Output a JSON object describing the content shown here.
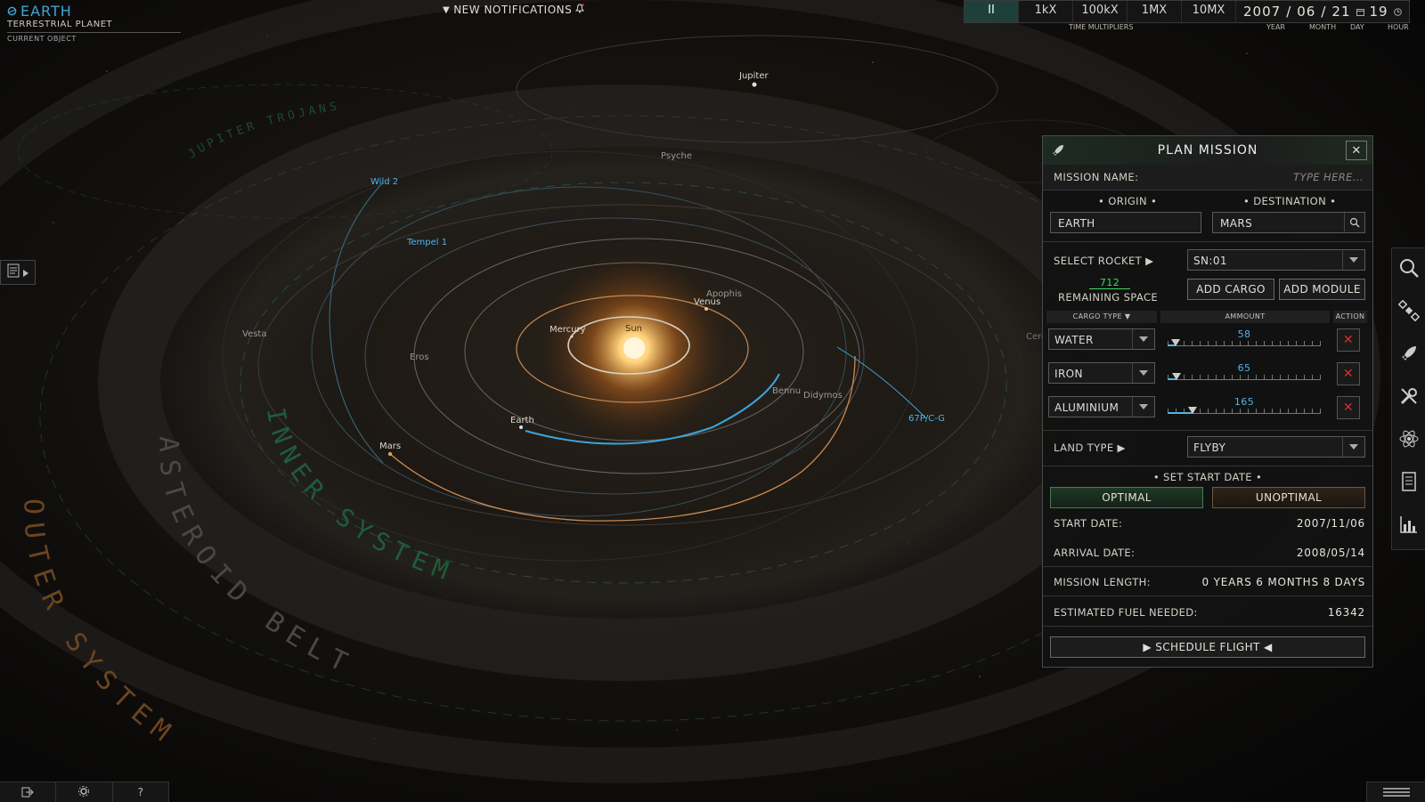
{
  "current_object": {
    "name": "EARTH",
    "type": "TERRESTRIAL PLANET",
    "label": "CURRENT OBJECT"
  },
  "notifications": {
    "label": "NEW NOTIFICATIONS"
  },
  "time": {
    "buttons": [
      "II",
      "1kX",
      "100kX",
      "1MX",
      "10MX"
    ],
    "year": "2007",
    "month": "06",
    "day": "21",
    "hour": "19",
    "multipliers_label": "TIME MULTIPLIERS",
    "labels": {
      "year": "YEAR",
      "month": "MONTH",
      "day": "DAY",
      "hour": "HOUR"
    }
  },
  "map": {
    "bodies": [
      "Jupiter",
      "Psyche",
      "Wild 2",
      "Tempel 1",
      "Vesta",
      "Eros",
      "Mercury",
      "Sun",
      "Venus",
      "Apophis",
      "Earth",
      "Mars",
      "Bennu",
      "Didymos",
      "Ceres",
      "67P/C-G"
    ],
    "regions": {
      "inner": "INNER SYSTEM",
      "belt": "ASTEROID BELT",
      "outer": "OUTER SYSTEM",
      "trojans": "JUPITER TROJANS"
    }
  },
  "panel": {
    "title": "PLAN MISSION",
    "mission_name_label": "MISSION NAME:",
    "mission_name_placeholder": "TYPE HERE...",
    "origin_label": "• ORIGIN •",
    "destination_label": "• DESTINATION •",
    "origin_value": "EARTH",
    "destination_value": "MARS",
    "select_rocket_label": "SELECT ROCKET ▶",
    "rocket_value": "SN:01",
    "remaining_space_value": "712",
    "remaining_space_label": "REMAINING SPACE",
    "add_cargo": "ADD CARGO",
    "add_module": "ADD MODULE",
    "table_headers": {
      "cargo_type": "CARGO TYPE ▼",
      "amount": "AMMOUNT",
      "action": "ACTION"
    },
    "cargo": [
      {
        "type": "WATER",
        "amount": "58",
        "fraction": 0.05
      },
      {
        "type": "IRON",
        "amount": "65",
        "fraction": 0.06
      },
      {
        "type": "ALUMINIUM",
        "amount": "165",
        "fraction": 0.16
      }
    ],
    "land_type_label": "LAND TYPE ▶",
    "land_type_value": "FLYBY",
    "set_start_date_label": "• SET START DATE •",
    "optimal": "OPTIMAL",
    "unoptimal": "UNOPTIMAL",
    "start_date_label": "START DATE:",
    "start_date_value": "2007/11/06",
    "arrival_date_label": "ARRIVAL DATE:",
    "arrival_date_value": "2008/05/14",
    "mission_length_label": "MISSION LENGTH:",
    "mission_length_value": "0 YEARS 6 MONTHS 8 DAYS",
    "fuel_label": "ESTIMATED FUEL NEEDED:",
    "fuel_value": "16342",
    "schedule": "▶ SCHEDULE FLIGHT ◀"
  },
  "colors": {
    "accent_blue": "#3fa3d6",
    "accent_green": "#3ddc5c",
    "danger_red": "#e02a2a",
    "orbit_orange": "#c98a50"
  }
}
